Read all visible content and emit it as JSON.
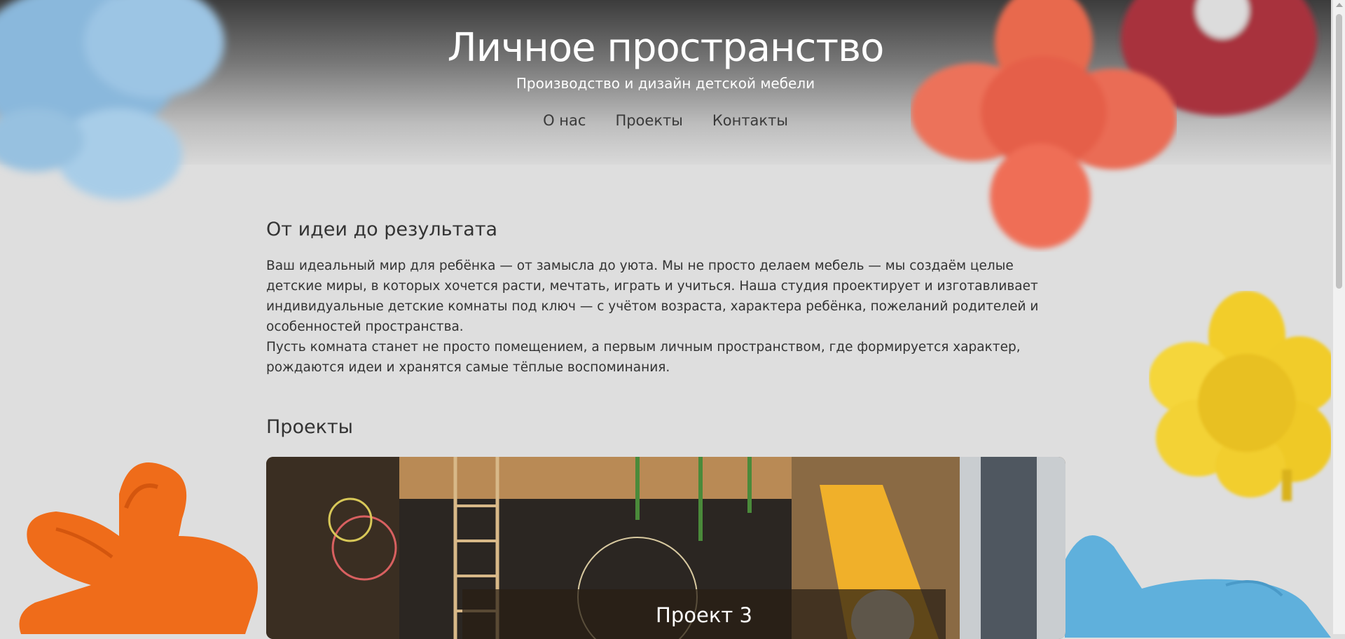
{
  "header": {
    "title": "Личное пространство",
    "subtitle": "Производство и дизайн детской мебели"
  },
  "nav": {
    "items": [
      "О нас",
      "Проекты",
      "Контакты"
    ]
  },
  "about": {
    "heading": "От идеи до результата",
    "paragraphs": [
      "Ваш идеальный мир для ребёнка — от замысла до уюта. Мы не просто делаем мебель — мы создаём целые детские миры, в которых хочется расти, мечтать, играть и учиться. Наша студия проектирует и изготавливает индивидуальные детские комнаты под ключ — с учётом возраста, характера ребёнка, пожеланий родителей и особенностей пространства.",
      "Пусть комната станет не просто помещением, а первым личным пространством, где формируется характер, рождаются идеи и хранятся самые тёплые воспоминания."
    ]
  },
  "projects": {
    "heading": "Проекты",
    "current_caption": "Проект 3"
  },
  "colors": {
    "background": "#dedede",
    "text": "#333333",
    "header_dark": "#3c3c3c"
  }
}
